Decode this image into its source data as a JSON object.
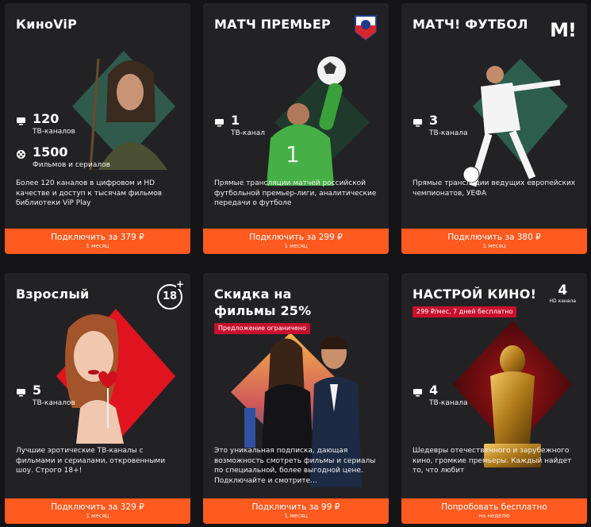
{
  "cards": [
    {
      "title": "КиноViP",
      "stats": [
        {
          "icon": "tv-icon",
          "value": "120",
          "label": "ТВ-каналов"
        },
        {
          "icon": "film-reel-icon",
          "value": "1500",
          "label": "Фильмов и сериалов"
        }
      ],
      "description": "Более 120 каналов в цифровом и HD качестве и доступ к тысячам фильмов библиотеки ViP Play",
      "cta": "Подключить за 379 ₽",
      "cta_sub": "1 месяц",
      "accent": "#2f5a4c"
    },
    {
      "title": "МАТЧ ПРЕМЬЕР",
      "logo": "rpl-bear-logo-icon",
      "stats": [
        {
          "icon": "tv-icon",
          "value": "1",
          "label": "ТВ-канал"
        }
      ],
      "description": "Прямые трансляции матчей российской футбольной премьер-лиги, аналитические передачи о футболе",
      "cta": "Подключить за 299 ₽",
      "cta_sub": "1 месяц",
      "accent": "#1f3a2c"
    },
    {
      "title": "МАТЧ! ФУТБОЛ",
      "logo": "match-m-logo-icon",
      "logo_text": "M!",
      "stats": [
        {
          "icon": "tv-icon",
          "value": "3",
          "label": "ТВ-канала"
        }
      ],
      "description": "Прямые трансляции ведущих европейских чемпионатов, УЕФА",
      "cta": "Подключить за 380 ₽",
      "cta_sub": "1 месяц",
      "accent": "#2d5e4d"
    },
    {
      "title": "Взрослый",
      "logo": "age-18-plus-icon",
      "logo_text": "18",
      "stats": [
        {
          "icon": "tv-icon",
          "value": "5",
          "label": "ТВ-каналов"
        }
      ],
      "description": "Лучшие эротические ТВ-каналы с фильмами и сериалами, откровенными шоу. Строго 18+!",
      "cta": "Подключить за 329 ₽",
      "cta_sub": "1 месяц",
      "accent": "#e0141e"
    },
    {
      "title": "Скидка на фильмы 25%",
      "badge": "Предложение ограничено",
      "description": "Это уникальная подписка, дающая возможность смотреть фильмы и сериалы по специальной, более выгодной цене. Подключайте и смотрите...",
      "cta": "Подключить за 99 ₽",
      "cta_sub": "1 месяц",
      "accent": "#e07030"
    },
    {
      "title": "НАСТРОЙ КИНО!",
      "badge": "299 ₽/мес, 7 дней бесплатно",
      "hd_count": "4",
      "hd_label": "HD канала",
      "stats": [
        {
          "icon": "tv-icon",
          "value": "4",
          "label": "ТВ-канала"
        }
      ],
      "description": "Шедевры отечественного и зарубежного кино, громкие премьеры. Каждый найдет то, что любит",
      "cta": "Попробовать бесплатно",
      "cta_sub": "на неделю",
      "accent": "#7a0f12"
    }
  ]
}
